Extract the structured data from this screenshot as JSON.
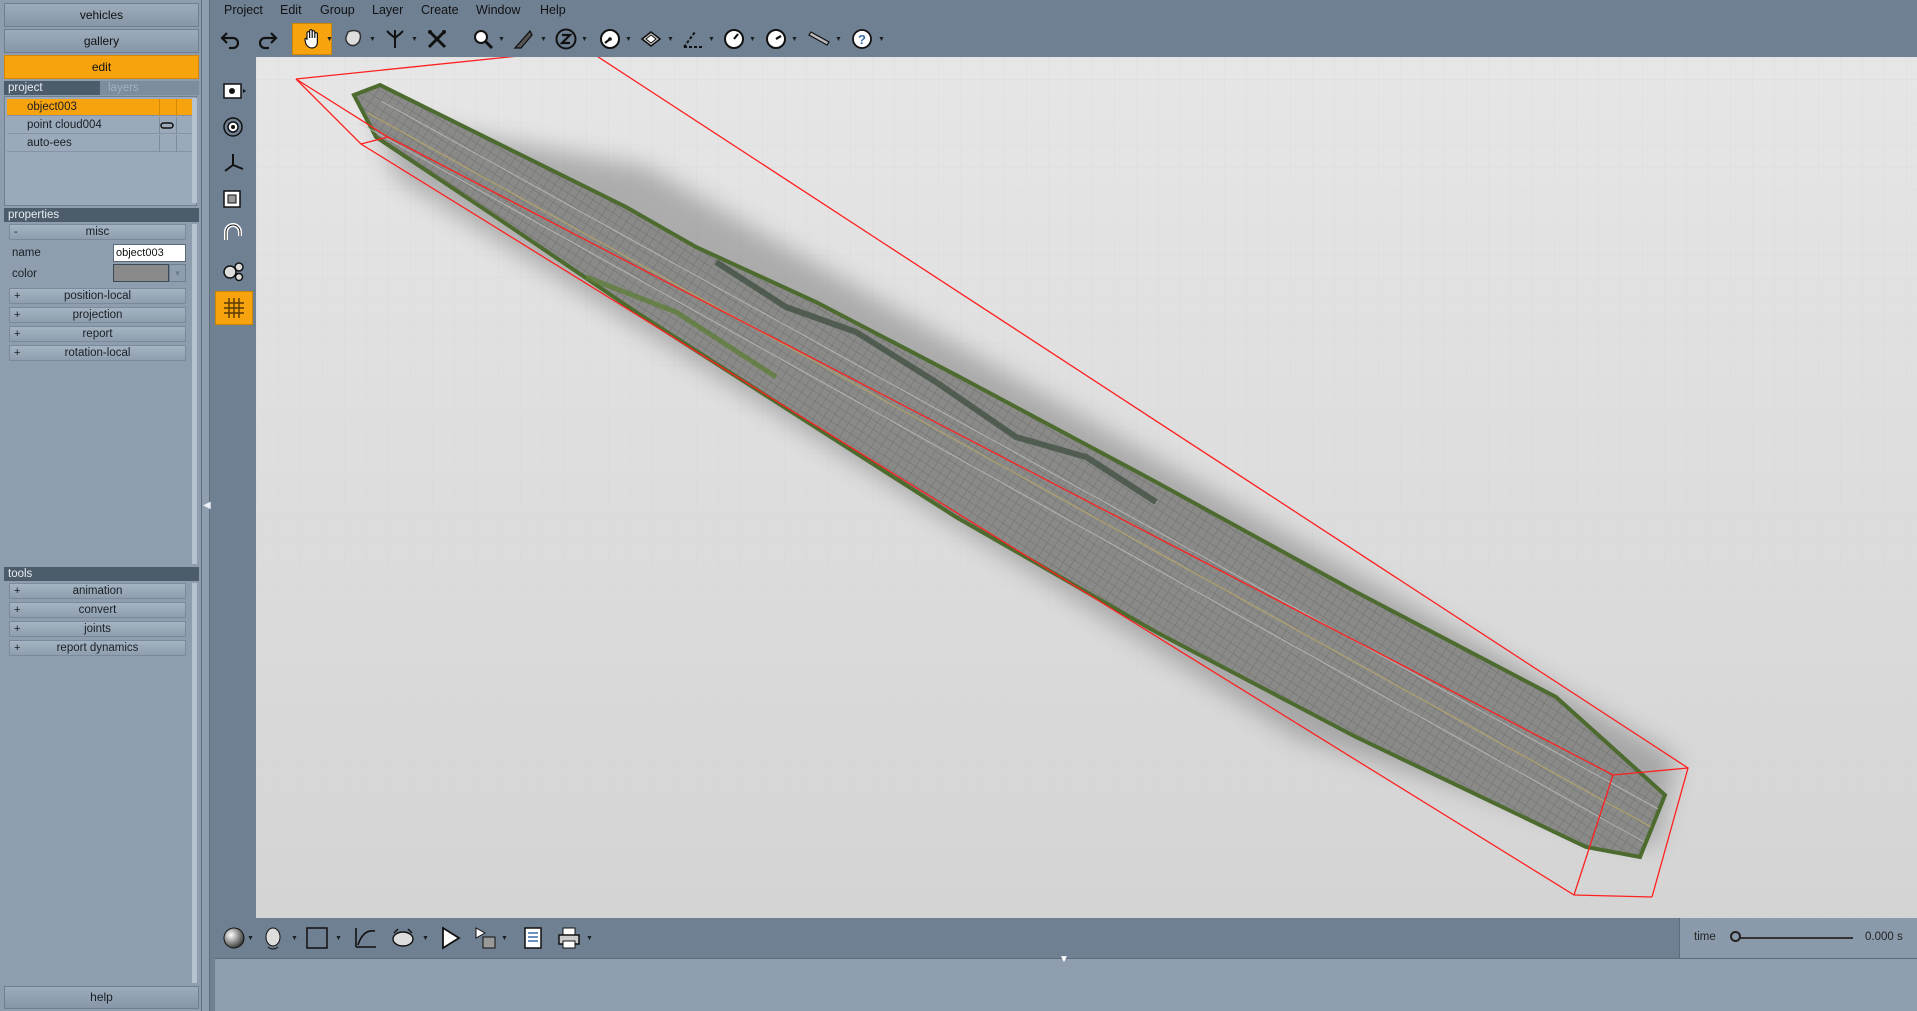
{
  "nav": {
    "vehicles": "vehicles",
    "gallery": "gallery",
    "edit": "edit"
  },
  "tabs": {
    "project": "project",
    "layers": "layers"
  },
  "project_items": [
    {
      "label": "object003",
      "selected": true
    },
    {
      "label": "point cloud004",
      "icon": "link-icon"
    },
    {
      "label": "auto-ees"
    }
  ],
  "properties": {
    "header": "properties",
    "misc": {
      "sign": "-",
      "label": "misc"
    },
    "name_label": "name",
    "name_value": "object003",
    "color_label": "color",
    "color_value": "#8a8a8a",
    "groups": [
      {
        "sign": "+",
        "label": "position-local"
      },
      {
        "sign": "+",
        "label": "projection"
      },
      {
        "sign": "+",
        "label": "report"
      },
      {
        "sign": "+",
        "label": "rotation-local"
      }
    ]
  },
  "tools": {
    "header": "tools",
    "groups": [
      {
        "sign": "+",
        "label": "animation"
      },
      {
        "sign": "+",
        "label": "convert"
      },
      {
        "sign": "+",
        "label": "joints"
      },
      {
        "sign": "+",
        "label": "report dynamics"
      }
    ]
  },
  "help": "help",
  "menu": [
    "Project",
    "Edit",
    "Group",
    "Layer",
    "Create",
    "Window",
    "Help"
  ],
  "toolbar_icons": [
    "undo-icon",
    "redo-icon",
    "pan-hand-icon",
    "select-lasso-icon",
    "pick-icon",
    "delete-x-icon",
    "zoom-icon",
    "knife-icon",
    "z-axis-icon",
    "measure-gauge-icon",
    "surface-icon",
    "angle-icon",
    "timer-icon",
    "timer-alt-icon",
    "tape-icon",
    "help-circle-icon"
  ],
  "side_icons": [
    "camera-icon",
    "target-icon",
    "axes-icon",
    "frame-icon",
    "magnet-icon",
    "gears-icon",
    "grid-icon"
  ],
  "bottom_icons": [
    "sphere-icon",
    "head-icon",
    "square-icon",
    "curve-icon",
    "camera-move-icon",
    "play-icon",
    "render-icon",
    "report-icon",
    "print-icon"
  ],
  "time": {
    "label": "time",
    "value": "0.000 s"
  },
  "colors": {
    "accent": "#f7a30e",
    "panel": "#8e9eae",
    "chrome": "#6f8093",
    "bbox": "#ff2020",
    "viewport": "#dcdcdc"
  }
}
